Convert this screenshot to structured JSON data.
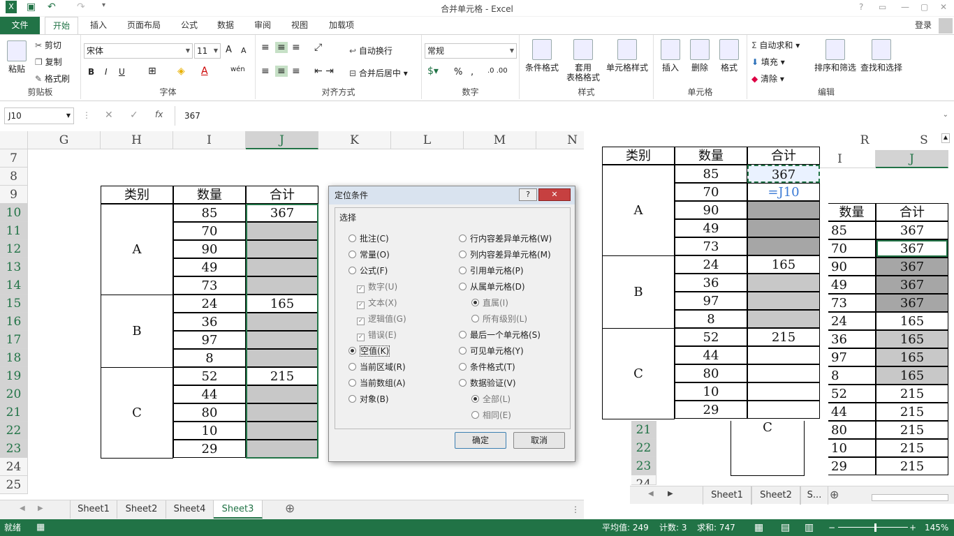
{
  "app": {
    "title": "合并单元格 - Excel",
    "user": "登录"
  },
  "window_buttons": [
    "?",
    "▭",
    "—",
    "▢",
    "✕"
  ],
  "tabs": [
    {
      "label": "文件"
    },
    {
      "label": "开始"
    },
    {
      "label": "插入"
    },
    {
      "label": "页面布局"
    },
    {
      "label": "公式"
    },
    {
      "label": "数据"
    },
    {
      "label": "审阅"
    },
    {
      "label": "视图"
    },
    {
      "label": "加载项"
    }
  ],
  "ribbon": {
    "clipboard": {
      "label": "剪贴板",
      "paste": "粘贴",
      "cut": "剪切",
      "copy": "复制",
      "painter": "格式刷"
    },
    "font": {
      "label": "字体",
      "name": "宋体",
      "size": "11",
      "bold": "B",
      "italic": "I",
      "underline": "U",
      "grow": "A",
      "shrink": "A",
      "phonetic": "wén"
    },
    "alignment": {
      "label": "对齐方式",
      "wrap": "自动换行",
      "merge": "合并后居中"
    },
    "number": {
      "label": "数字",
      "format": "常规",
      "percent": "%",
      "comma": ","
    },
    "styles": {
      "label": "样式",
      "conditional": "条件格式",
      "table1": "套用",
      "table2": "表格格式",
      "cellstyle": "单元格样式"
    },
    "cells": {
      "label": "单元格",
      "insert": "插入",
      "delete": "删除",
      "format": "格式"
    },
    "editing": {
      "label": "编辑",
      "autosum": "自动求和",
      "fill": "填充",
      "clear": "清除",
      "sort": "排序和筛选",
      "find": "查找和选择"
    }
  },
  "formula_bar": {
    "name_box": "J10",
    "fx": "fx",
    "value": "367"
  },
  "columns_left": [
    "G",
    "H",
    "I",
    "J",
    "K",
    "L",
    "M",
    "N"
  ],
  "rows_left": [
    "7",
    "8",
    "9",
    "10",
    "11",
    "12",
    "13",
    "14",
    "15",
    "16",
    "17",
    "18",
    "19",
    "20",
    "21",
    "22",
    "23",
    "24",
    "25"
  ],
  "table_left": {
    "headers": [
      "类别",
      "数量",
      "合计"
    ],
    "groups": [
      "A",
      "B",
      "C"
    ],
    "quantities": [
      "85",
      "70",
      "90",
      "49",
      "73",
      "24",
      "36",
      "97",
      "8",
      "52",
      "44",
      "80",
      "10",
      "29"
    ],
    "totals": [
      "367",
      "165",
      "215"
    ]
  },
  "dialog": {
    "title": "定位条件",
    "help": "?",
    "close": "✕",
    "group_label": "选择",
    "left_options": [
      "批注(C)",
      "常量(O)",
      "公式(F)",
      "空值(K)",
      "当前区域(R)",
      "当前数组(A)",
      "对象(B)"
    ],
    "formula_sub": [
      "数字(U)",
      "文本(X)",
      "逻辑值(G)",
      "错误(E)"
    ],
    "right_options": [
      "行内容差异单元格(W)",
      "列内容差异单元格(M)",
      "引用单元格(P)",
      "从属单元格(D)",
      "最后一个单元格(S)",
      "可见单元格(Y)",
      "条件格式(T)",
      "数据验证(V)"
    ],
    "dependent_sub": [
      "直属(I)",
      "所有级别(L)"
    ],
    "validation_sub": [
      "全部(L)",
      "相同(E)"
    ],
    "ok": "确定",
    "cancel": "取消"
  },
  "overlay": {
    "col_headers": [
      "R",
      "S"
    ],
    "col_headers2": [
      "I",
      "J"
    ],
    "table": {
      "headers": [
        "类别",
        "数量",
        "合计"
      ],
      "groups": [
        "A",
        "B",
        "C"
      ],
      "quantities": [
        "85",
        "70",
        "90",
        "49",
        "73",
        "24",
        "36",
        "97",
        "8",
        "52",
        "44",
        "80",
        "10",
        "29"
      ],
      "totals": [
        "367",
        "165",
        "215"
      ],
      "formula": "=J10"
    },
    "right_table": {
      "headers": [
        "数量",
        "合计"
      ],
      "quantities": [
        "85",
        "70",
        "90",
        "49",
        "73",
        "24",
        "36",
        "97",
        "8",
        "52",
        "44",
        "80",
        "10",
        "29"
      ],
      "totals": [
        "367",
        "367",
        "367",
        "367",
        "367",
        "165",
        "165",
        "165",
        "165",
        "215",
        "215",
        "215",
        "215",
        "215"
      ]
    },
    "rows": [
      "21",
      "22",
      "23",
      "24"
    ],
    "group_c": "C",
    "sheets": [
      "Sheet1",
      "Sheet2",
      "S..."
    ]
  },
  "sheets": [
    "Sheet1",
    "Sheet2",
    "Sheet4",
    "Sheet3"
  ],
  "status": {
    "ready": "就绪",
    "average": "平均值: 249",
    "count": "计数: 3",
    "sum": "求和: 747",
    "zoom": "145%"
  }
}
